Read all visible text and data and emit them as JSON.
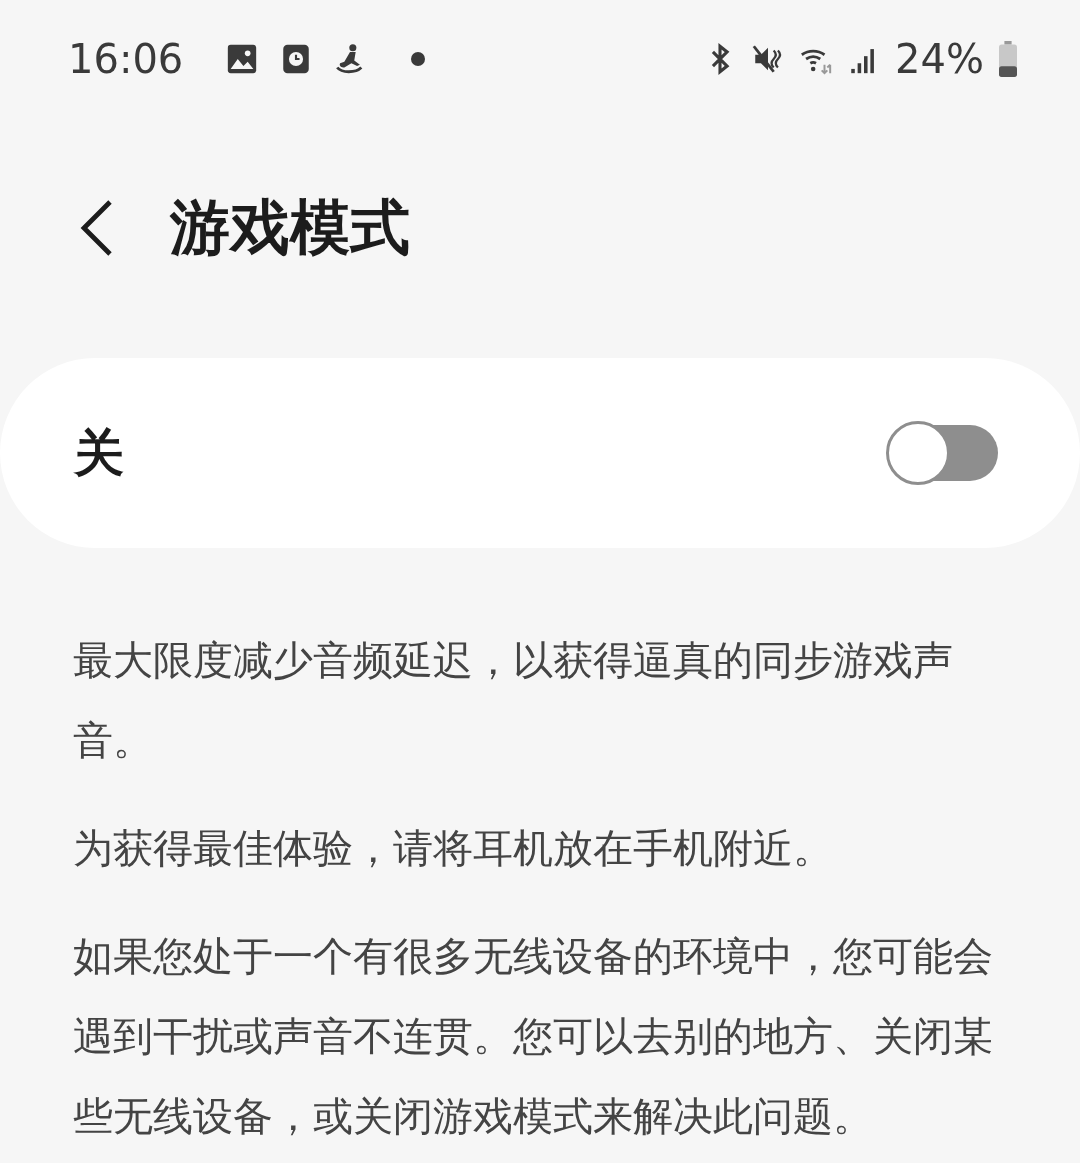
{
  "status_bar": {
    "time": "16:06",
    "battery": "24%"
  },
  "header": {
    "title": "游戏模式"
  },
  "toggle": {
    "label": "关",
    "on": false
  },
  "paragraphs": [
    "最大限度减少音频延迟，以获得逼真的同步游戏声音。",
    "为获得最佳体验，请将耳机放在手机附近。",
    "如果您处于一个有很多无线设备的环境中，您可能会遇到干扰或声音不连贯。您可以去别的地方、关闭某些无线设备，或关闭游戏模式来解决此问题。"
  ]
}
